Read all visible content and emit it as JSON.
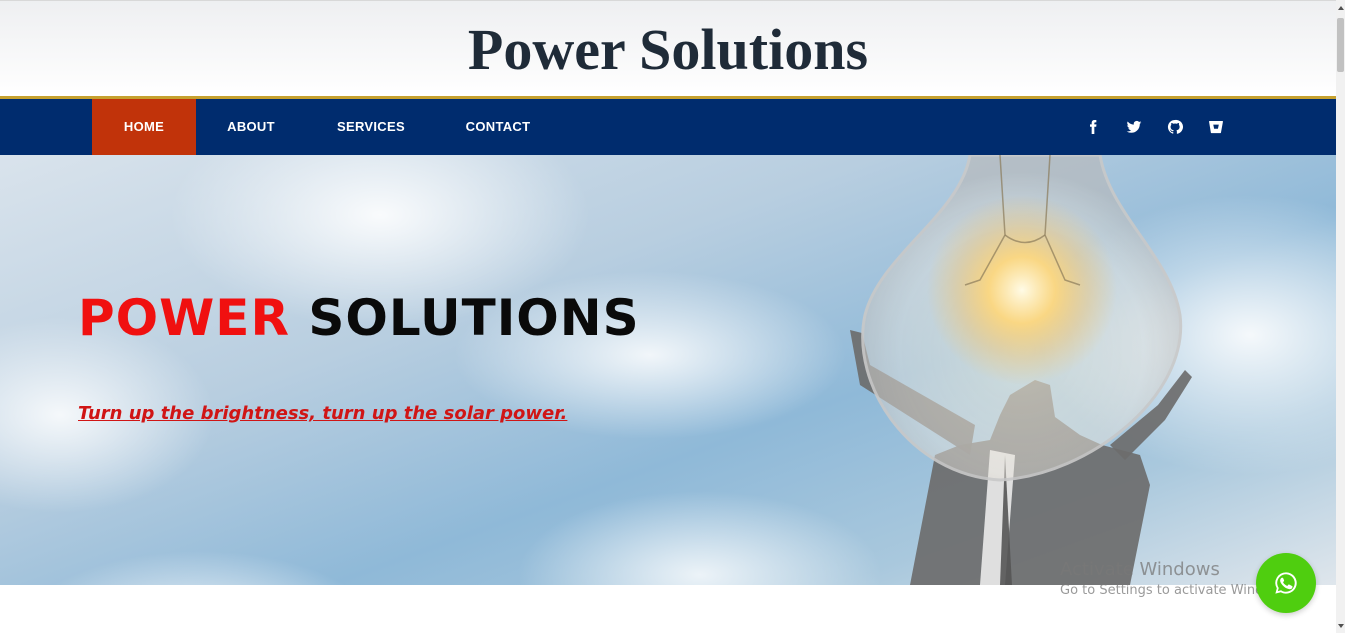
{
  "header": {
    "site_title": "Power Solutions"
  },
  "nav": {
    "items": [
      {
        "label": "HOME",
        "active": true
      },
      {
        "label": "ABOUT",
        "active": false
      },
      {
        "label": "SERVICES",
        "active": false
      },
      {
        "label": "CONTACT",
        "active": false
      }
    ],
    "social_icons": [
      "facebook-icon",
      "twitter-icon",
      "github-icon",
      "bitbucket-icon"
    ]
  },
  "hero": {
    "title_red": "POWER",
    "title_dark": "SOLUTIONS",
    "tagline": "Turn up the brightness, turn up the solar power."
  },
  "watermark": {
    "title": "Activate Windows",
    "subtitle": "Go to Settings to activate Windows."
  },
  "floating": {
    "whatsapp_icon": "whatsapp-icon"
  },
  "colors": {
    "nav_bg": "#002c6e",
    "nav_active": "#c1330a",
    "gold_rule": "#c6a12e",
    "title_red": "#f01010",
    "tagline_red": "#d01515",
    "whatsapp_green": "#4fce0f"
  }
}
